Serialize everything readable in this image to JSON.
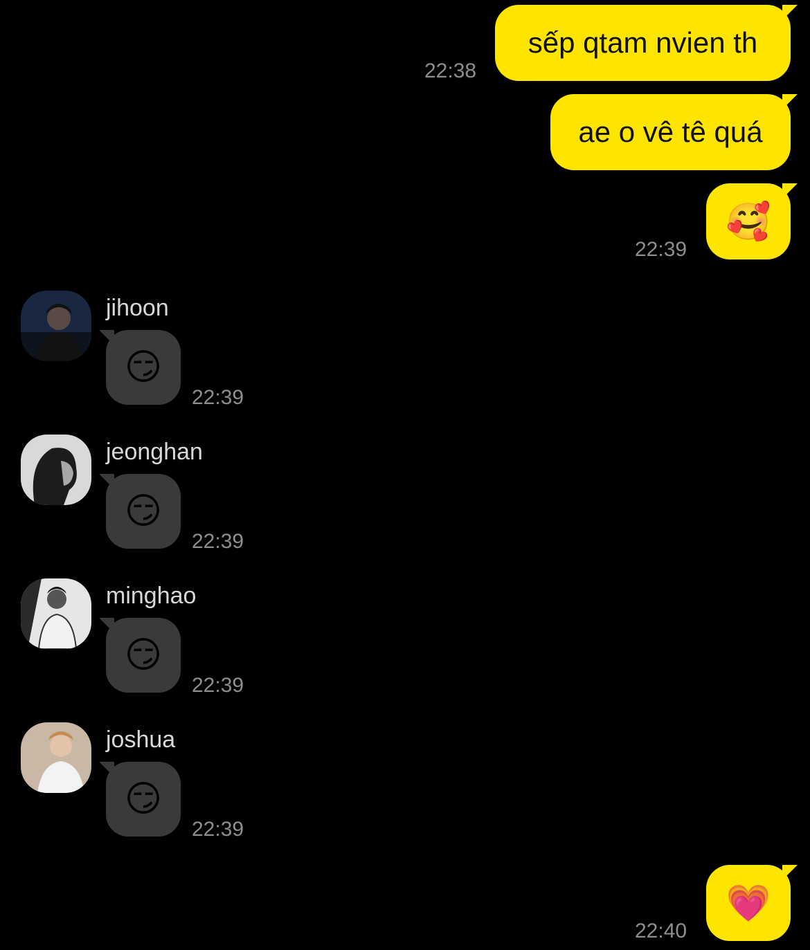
{
  "outgoing": [
    {
      "text": "sếp qtam nvien th",
      "time": "22:38"
    },
    {
      "text": "ae o vê tê quá",
      "time": ""
    },
    {
      "text": "🥰",
      "time": "22:39"
    }
  ],
  "incoming": [
    {
      "sender": "jihoon",
      "text": "😏",
      "time": "22:39",
      "avatar_icon": "person-photo"
    },
    {
      "sender": "jeonghan",
      "text": "😏",
      "time": "22:39",
      "avatar_icon": "person-photo"
    },
    {
      "sender": "minghao",
      "text": "😏",
      "time": "22:39",
      "avatar_icon": "person-photo"
    },
    {
      "sender": "joshua",
      "text": "😏",
      "time": "22:39",
      "avatar_icon": "person-photo"
    }
  ],
  "final": {
    "text": "💗",
    "time": "22:40"
  },
  "colors": {
    "outgoing_bubble": "#FEE500",
    "incoming_bubble": "#3a3a3a",
    "background": "#000000",
    "timestamp": "#8e8e8e"
  }
}
